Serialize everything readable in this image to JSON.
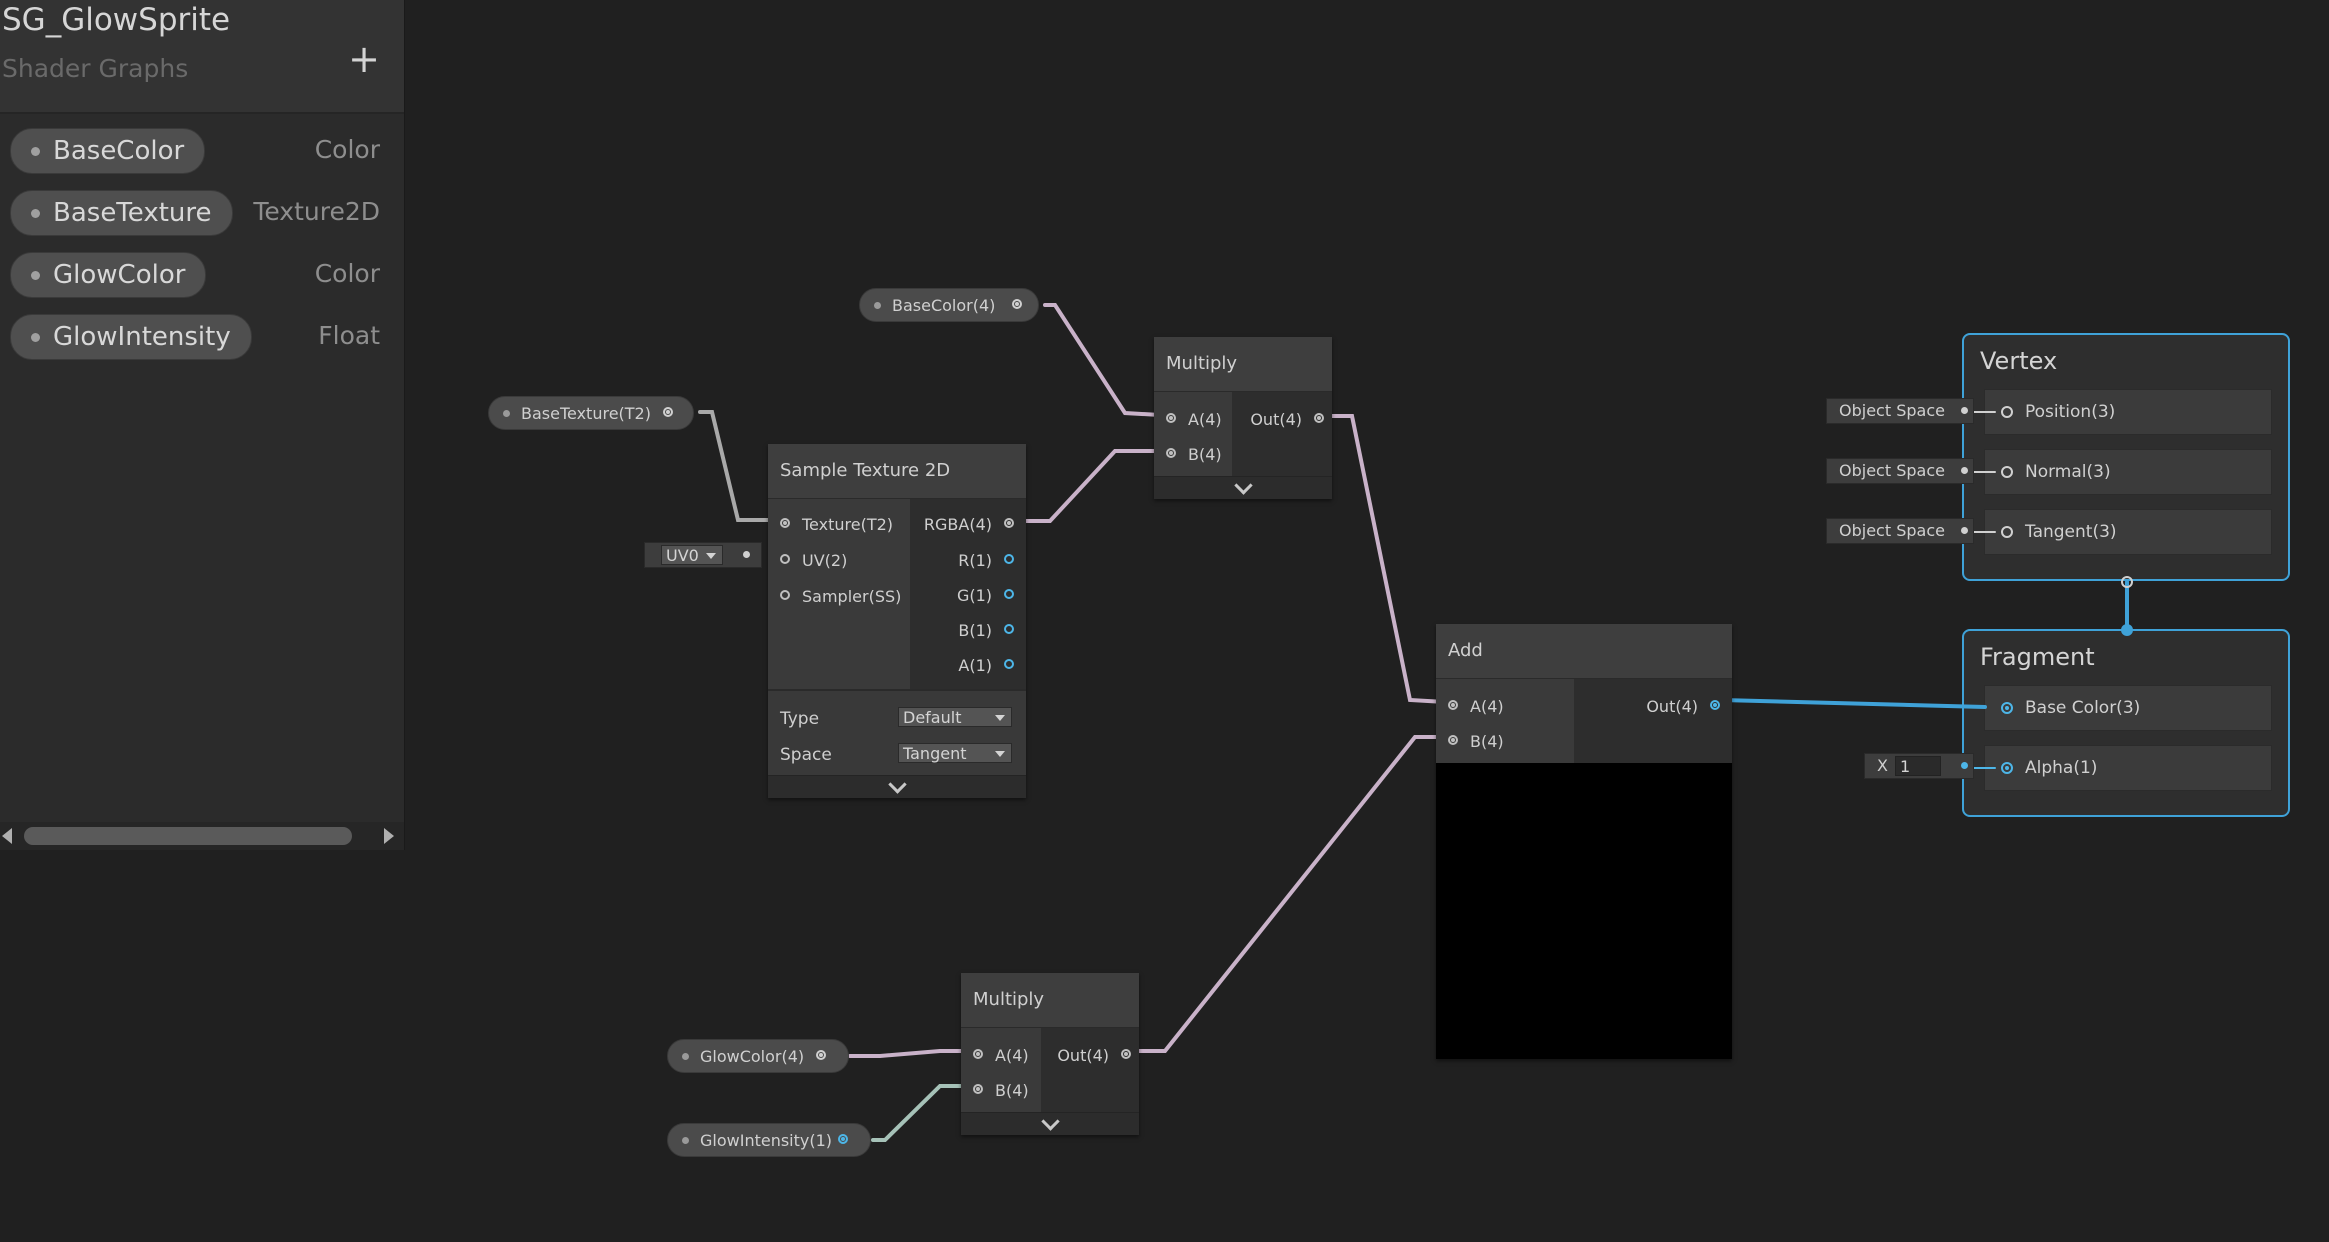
{
  "blackboard": {
    "title": "SG_GlowSprite",
    "subtitle": "Shader Graphs",
    "add_label": "+",
    "properties": [
      {
        "name": "BaseColor",
        "type": "Color"
      },
      {
        "name": "BaseTexture",
        "type": "Texture2D"
      },
      {
        "name": "GlowColor",
        "type": "Color"
      },
      {
        "name": "GlowIntensity",
        "type": "Float"
      }
    ]
  },
  "graph": {
    "prop_nodes": {
      "base_color": "BaseColor(4)",
      "base_texture": "BaseTexture(T2)",
      "glow_color": "GlowColor(4)",
      "glow_intensity": "GlowIntensity(1)"
    },
    "sample_texture": {
      "title": "Sample Texture 2D",
      "inputs": [
        "Texture(T2)",
        "UV(2)",
        "Sampler(SS)"
      ],
      "outputs": [
        "RGBA(4)",
        "R(1)",
        "G(1)",
        "B(1)",
        "A(1)"
      ],
      "uv_value": "UV0",
      "type_label": "Type",
      "type_value": "Default",
      "space_label": "Space",
      "space_value": "Tangent"
    },
    "multiply_top": {
      "title": "Multiply",
      "in_a": "A(4)",
      "in_b": "B(4)",
      "out": "Out(4)"
    },
    "multiply_bottom": {
      "title": "Multiply",
      "in_a": "A(4)",
      "in_b": "B(4)",
      "out": "Out(4)"
    },
    "add": {
      "title": "Add",
      "in_a": "A(4)",
      "in_b": "B(4)",
      "out": "Out(4)"
    },
    "vertex": {
      "title": "Vertex",
      "blocks": [
        "Position(3)",
        "Normal(3)",
        "Tangent(3)"
      ],
      "space_value": "Object Space"
    },
    "fragment": {
      "title": "Fragment",
      "blocks": [
        "Base Color(3)",
        "Alpha(1)"
      ],
      "alpha_axis": "X",
      "alpha_value": "1"
    }
  },
  "colors": {
    "wire_color": "#c9b2c9",
    "wire_float": "#a6c2b8",
    "wire_vec3": "#3fa2d8",
    "stack_border": "#3fa2d8"
  }
}
